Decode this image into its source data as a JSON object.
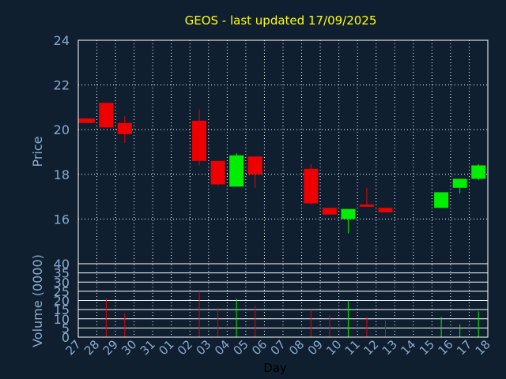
{
  "colors": {
    "background": "#0f1f30",
    "title": "#ffff00",
    "axis_text": "#8aa9cc",
    "frame": "#ffffff",
    "grid": "#ffffff",
    "up": "#00ee00",
    "down": "#ee0000",
    "xlabel": "#000000"
  },
  "chart_data": {
    "type": "candlestick",
    "title": "GEOS - last updated 17/09/2025",
    "xlabel": "Day",
    "grid": true,
    "price_panel": {
      "ylabel": "Price",
      "ylim": [
        14,
        24
      ],
      "yticks": [
        "24",
        "22",
        "20",
        "18",
        "16"
      ]
    },
    "volume_panel": {
      "ylabel": "Volume (0000)",
      "ylim": [
        0,
        40
      ],
      "yticks": [
        "40",
        "35",
        "30",
        "25",
        "20",
        "15",
        "10",
        "5",
        "0"
      ]
    },
    "x_labels": [
      "27",
      "28",
      "29",
      "30",
      "31",
      "01",
      "02",
      "03",
      "04",
      "05",
      "06",
      "07",
      "08",
      "09",
      "10",
      "11",
      "12",
      "13",
      "14",
      "15",
      "16",
      "17",
      "18"
    ],
    "candles": [
      {
        "i": 0,
        "open": 20.5,
        "close": 20.3,
        "high": 20.5,
        "low": 20.3,
        "volume": 0
      },
      {
        "i": 1,
        "open": 21.2,
        "close": 20.1,
        "high": 21.2,
        "low": 20.1,
        "volume": 21
      },
      {
        "i": 2,
        "open": 20.3,
        "close": 19.8,
        "high": 20.6,
        "low": 19.4,
        "volume": 13
      },
      {
        "i": 6,
        "open": 20.4,
        "close": 18.6,
        "high": 20.9,
        "low": 18.4,
        "volume": 25
      },
      {
        "i": 7,
        "open": 18.6,
        "close": 17.55,
        "high": 18.6,
        "low": 17.5,
        "volume": 16
      },
      {
        "i": 8,
        "open": 17.45,
        "close": 18.85,
        "high": 18.95,
        "low": 17.45,
        "volume": 21
      },
      {
        "i": 9,
        "open": 18.8,
        "close": 18.0,
        "high": 18.8,
        "low": 17.4,
        "volume": 17
      },
      {
        "i": 12,
        "open": 18.25,
        "close": 16.7,
        "high": 18.45,
        "low": 16.65,
        "volume": 15
      },
      {
        "i": 13,
        "open": 16.5,
        "close": 16.2,
        "high": 16.5,
        "low": 16.2,
        "volume": 12
      },
      {
        "i": 14,
        "open": 16.0,
        "close": 16.45,
        "high": 16.45,
        "low": 15.35,
        "volume": 20
      },
      {
        "i": 15,
        "open": 16.65,
        "close": 16.55,
        "high": 17.4,
        "low": 16.55,
        "volume": 11
      },
      {
        "i": 16,
        "open": 16.5,
        "close": 16.3,
        "high": 16.5,
        "low": 16.3,
        "volume": 9
      },
      {
        "i": 19,
        "open": 16.5,
        "close": 17.2,
        "high": 17.2,
        "low": 16.5,
        "volume": 11
      },
      {
        "i": 20,
        "open": 17.4,
        "close": 17.8,
        "high": 17.8,
        "low": 17.15,
        "volume": 7
      },
      {
        "i": 21,
        "open": 17.8,
        "close": 18.4,
        "high": 18.45,
        "low": 17.75,
        "volume": 14
      }
    ]
  }
}
